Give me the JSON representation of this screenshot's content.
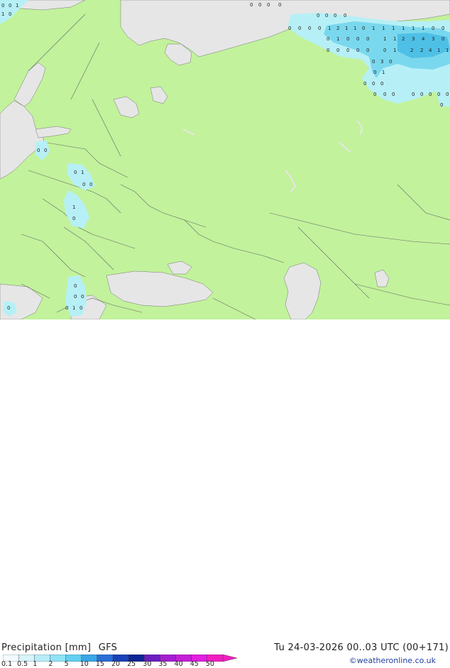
{
  "map": {
    "colors": {
      "land": "#c2f29c",
      "sea": "#e6e6e6",
      "border": "#666666",
      "precip_light": "#b6f0f6",
      "precip_mid": "#7ad8ee",
      "precip_heavy": "#4ec0e6"
    },
    "value_labels": [
      {
        "text": "0"
      },
      {
        "text": "1"
      },
      {
        "text": "2"
      },
      {
        "text": "3"
      },
      {
        "text": "4"
      }
    ]
  },
  "legend": {
    "title": "Precipitation [mm]",
    "model": "GFS",
    "run": "Tu 24-03-2026 00..03 UTC (00+171)",
    "credit": "©weatheronline.co.uk",
    "scale": [
      {
        "label": "0.1",
        "color": "#f2fbff"
      },
      {
        "label": "0.5",
        "color": "#d8f4fb"
      },
      {
        "label": "1",
        "color": "#b6ecf8"
      },
      {
        "label": "2",
        "color": "#92e2f5"
      },
      {
        "label": "5",
        "color": "#62d0f0"
      },
      {
        "label": "10",
        "color": "#3aa6e6"
      },
      {
        "label": "15",
        "color": "#2a6fd6"
      },
      {
        "label": "20",
        "color": "#1a42b8"
      },
      {
        "label": "25",
        "color": "#0d2494"
      },
      {
        "label": "30",
        "color": "#6a1ec0"
      },
      {
        "label": "35",
        "color": "#a41ed0"
      },
      {
        "label": "40",
        "color": "#c41ed6"
      },
      {
        "label": "45",
        "color": "#e21ee0"
      },
      {
        "label": "50",
        "color": "#f01ec0"
      }
    ]
  }
}
